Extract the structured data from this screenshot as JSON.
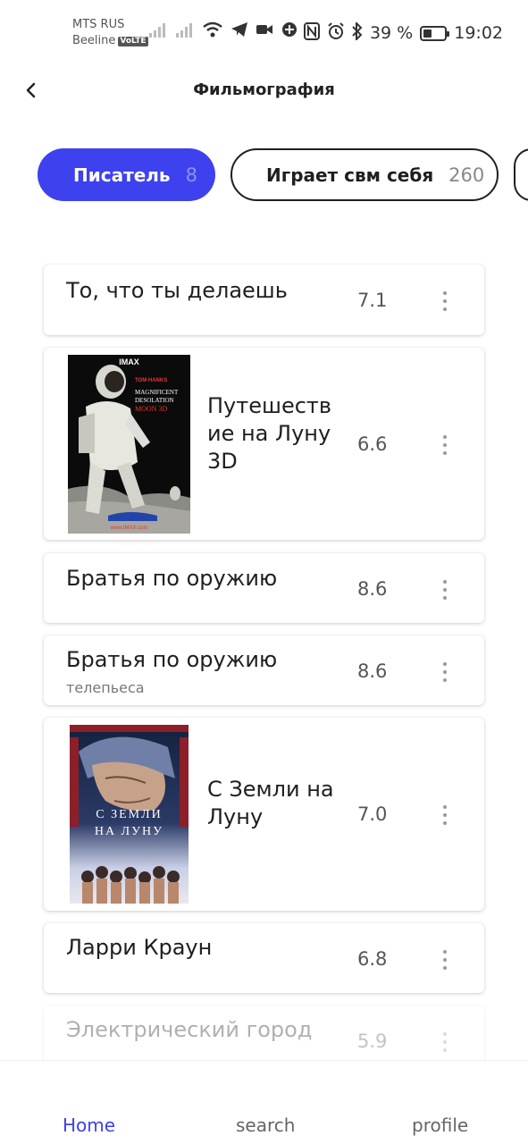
{
  "status_bar": {
    "carrier_1": "MTS RUS",
    "carrier_2": "Beeline",
    "volte": "VoLTE",
    "battery_percent": "39 %",
    "battery_level": 0.39,
    "time": "19:02",
    "icons": [
      "signal-icon",
      "signal-icon",
      "wifi-icon",
      "telegram-icon",
      "video-icon",
      "vpn-icon",
      "nfc-icon",
      "alarm-icon",
      "bluetooth-icon",
      "battery-icon"
    ]
  },
  "header": {
    "title": "Фильмография",
    "back_icon": "chevron-left-icon"
  },
  "chips": [
    {
      "label": "Писатель",
      "count": "8",
      "active": true
    },
    {
      "label": "Играет свм себя",
      "count": "260",
      "active": false
    }
  ],
  "films": [
    {
      "title": "То, что ты делаешь",
      "subtitle": "",
      "rating": "7.1",
      "has_poster": false
    },
    {
      "title": "Путешеств ие на Луну 3D",
      "subtitle": "",
      "rating": "6.6",
      "has_poster": true
    },
    {
      "title": "Братья по оружию",
      "subtitle": "",
      "rating": "8.6",
      "has_poster": false
    },
    {
      "title": "Братья по оружию",
      "subtitle": "телепьеса",
      "rating": "8.6",
      "has_poster": false
    },
    {
      "title": "С Земли на Луну",
      "subtitle": "",
      "rating": "7.0",
      "has_poster": true
    },
    {
      "title": "Ларри Краун",
      "subtitle": "",
      "rating": "6.8",
      "has_poster": false
    },
    {
      "title": "Электрический город",
      "subtitle": "",
      "rating": "5.9",
      "has_poster": false
    }
  ],
  "posters": {
    "moon_3d": {
      "brand": "IMAX",
      "line_1": "TOM HANKS",
      "line_2": "MAGNIFICENT",
      "line_3": "DESOLATION",
      "line_4": "MOON 3D",
      "footer": "www.IMAX.com"
    },
    "earth_to_moon": {
      "line_1": "С ЗЕМЛИ",
      "line_2": "НА ЛУНУ"
    }
  },
  "bottom_nav": {
    "home": "Home",
    "search": "search",
    "profile": "profile"
  },
  "colors": {
    "accent": "#3d41ee",
    "text": "#1f1f1f",
    "muted": "#777777"
  }
}
